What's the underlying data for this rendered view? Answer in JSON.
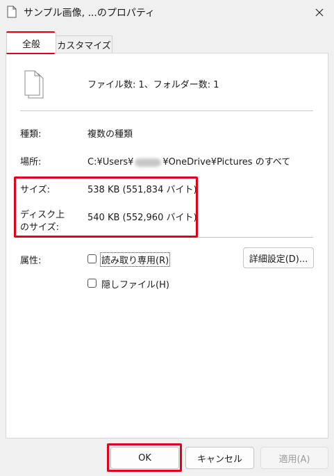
{
  "window": {
    "title": "サンプル画像, ...のプロパティ",
    "close_glyph": "✕"
  },
  "tabs": [
    {
      "label": "全般",
      "active": true
    },
    {
      "label": "カスタマイズ",
      "active": false
    }
  ],
  "summary": {
    "text": "ファイル数: 1、フォルダー数: 1"
  },
  "info": {
    "type_label": "種類:",
    "type_value": "複数の種類",
    "location_label": "場所:",
    "location_prefix": "C:¥Users¥",
    "location_suffix": "¥OneDrive¥Pictures のすべて",
    "size_label": "サイズ:",
    "size_value": "538 KB (551,834 バイト)",
    "disk_size_label_line1": "ディスク上",
    "disk_size_label_line2": "のサイズ:",
    "disk_size_value": "540 KB (552,960 バイト)"
  },
  "attributes": {
    "label": "属性:",
    "readonly_label": "読み取り専用(R)",
    "hidden_label": "隠しファイル(H)",
    "readonly_checked": false,
    "hidden_checked": false,
    "advanced_button": "詳細設定(D)..."
  },
  "footer": {
    "ok": "OK",
    "cancel": "キャンセル",
    "apply": "適用(A)"
  },
  "colors": {
    "highlight_red": "#e0001a",
    "dialog_bg": "#f0f0f0",
    "panel_bg": "#ffffff"
  }
}
